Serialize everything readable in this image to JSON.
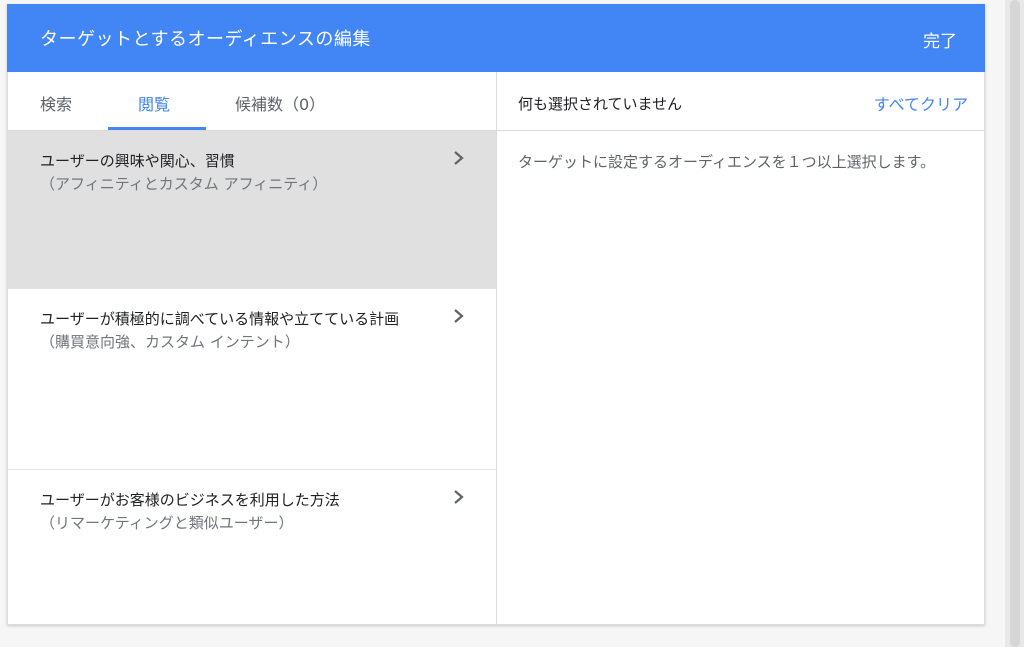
{
  "dialog": {
    "title": "ターゲットとするオーディエンスの編集",
    "done_label": "完了"
  },
  "tabs": [
    {
      "label": "検索"
    },
    {
      "label": "閲覧"
    },
    {
      "label": "候補数（0）"
    }
  ],
  "categories": [
    {
      "title": "ユーザーの興味や関心、習慣",
      "subtitle": "（アフィニティとカスタム アフィニティ）"
    },
    {
      "title": "ユーザーが積極的に調べている情報や立てている計画",
      "subtitle": "（購買意向強、カスタム インテント）"
    },
    {
      "title": "ユーザーがお客様のビジネスを利用した方法",
      "subtitle": "（リマーケティングと類似ユーザー）"
    }
  ],
  "selection": {
    "status": "何も選択されていません",
    "clear_all_label": "すべてクリア",
    "hint": "ターゲットに設定するオーディエンスを１つ以上選択します。"
  },
  "colors": {
    "accent": "#4285f4",
    "selected_row": "#e0e0e0"
  }
}
